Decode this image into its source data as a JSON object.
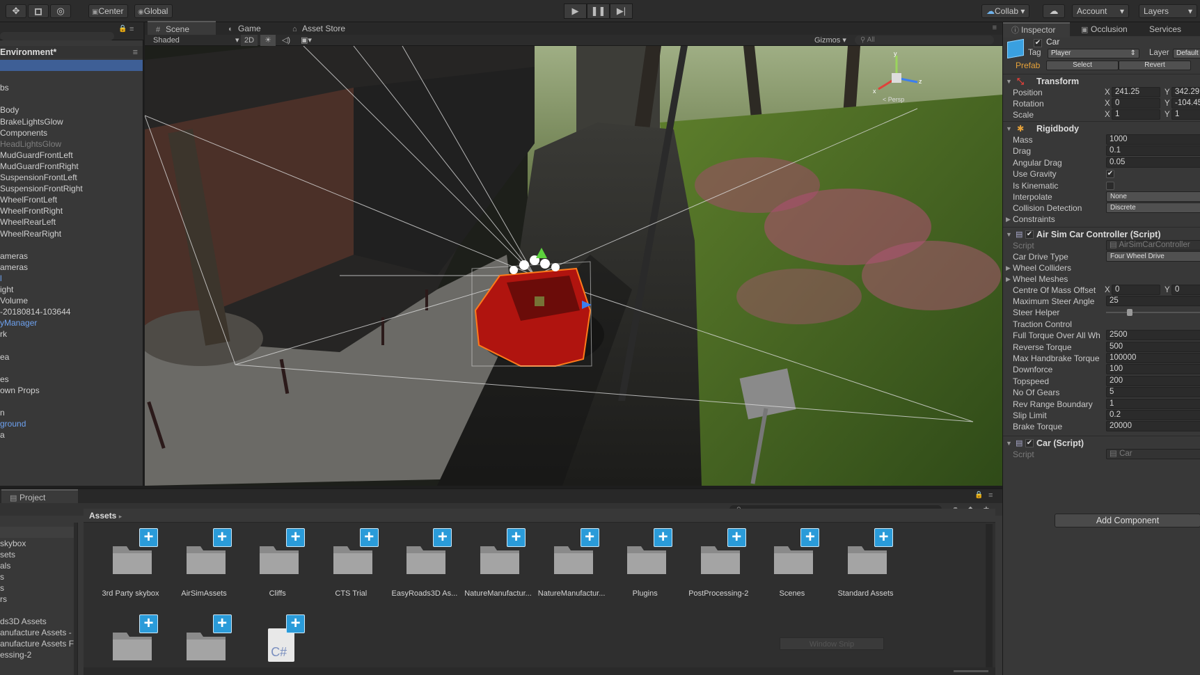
{
  "toolbar": {
    "pivot_center": "Center",
    "pivot_global": "Global",
    "collab": "Collab",
    "account": "Account",
    "layers": "Layers"
  },
  "scene_tabs": [
    "Scene",
    "Game",
    "Asset Store"
  ],
  "scene_toolbar": {
    "draw_mode": "Shaded",
    "mode_2d": "2D",
    "gizmos": "Gizmos",
    "search_placeholder": "All"
  },
  "hierarchy": {
    "title": "Environment*",
    "items": [
      {
        "label": "",
        "style": "sel"
      },
      {
        "label": "",
        "style": ""
      },
      {
        "label": "bs",
        "style": ""
      },
      {
        "label": "",
        "style": ""
      },
      {
        "label": "Body",
        "style": ""
      },
      {
        "label": "BrakeLightsGlow",
        "style": ""
      },
      {
        "label": "Components",
        "style": ""
      },
      {
        "label": "HeadLightsGlow",
        "style": "gray"
      },
      {
        "label": "MudGuardFrontLeft",
        "style": ""
      },
      {
        "label": "MudGuardFrontRight",
        "style": ""
      },
      {
        "label": "SuspensionFrontLeft",
        "style": ""
      },
      {
        "label": "SuspensionFrontRight",
        "style": ""
      },
      {
        "label": "WheelFrontLeft",
        "style": ""
      },
      {
        "label": "WheelFrontRight",
        "style": ""
      },
      {
        "label": "WheelRearLeft",
        "style": ""
      },
      {
        "label": "WheelRearRight",
        "style": ""
      },
      {
        "label": "",
        "style": ""
      },
      {
        "label": "ameras",
        "style": ""
      },
      {
        "label": "ameras",
        "style": ""
      },
      {
        "label": "l",
        "style": "blue"
      },
      {
        "label": "ight",
        "style": ""
      },
      {
        "label": " Volume",
        "style": ""
      },
      {
        "label": "-20180814-103644",
        "style": ""
      },
      {
        "label": "yManager",
        "style": "blue"
      },
      {
        "label": "rk",
        "style": ""
      },
      {
        "label": "",
        "style": ""
      },
      {
        "label": "ea",
        "style": ""
      },
      {
        "label": "",
        "style": ""
      },
      {
        "label": "es",
        "style": ""
      },
      {
        "label": "own Props",
        "style": ""
      },
      {
        "label": "",
        "style": ""
      },
      {
        "label": "n",
        "style": ""
      },
      {
        "label": "ground",
        "style": "blue"
      },
      {
        "label": "a",
        "style": ""
      }
    ]
  },
  "project": {
    "tab": "Project",
    "breadcrumb": "Assets",
    "left_items": [
      " skybox",
      "sets",
      "als",
      "s",
      "s",
      "rs",
      "",
      "ds3D Assets",
      "anufacture Assets -",
      "anufacture Assets F",
      "essing-2"
    ],
    "assets_row1": [
      "3rd Party skybox",
      "AirSimAssets",
      "Cliffs",
      "CTS Trial",
      "EasyRoads3D As...",
      "NatureManufactur...",
      "NatureManufactur...",
      "Plugins",
      "PostProcessing-2",
      "Scenes",
      "Standard Assets"
    ],
    "assets_row2": [
      "",
      "",
      ""
    ],
    "script_glyph": "C#",
    "window_snip": "Window Snip"
  },
  "inspector": {
    "tabs": [
      "Inspector",
      "Occlusion",
      "Services"
    ],
    "object_name": "Car",
    "tag_label": "Tag",
    "tag_value": "Player",
    "layer_label": "Layer",
    "layer_value": "Default",
    "prefab_label": "Prefab",
    "prefab_select": "Select",
    "prefab_revert": "Revert",
    "transform": {
      "title": "Transform",
      "position": {
        "label": "Position",
        "x": "241.25",
        "y": "342.29"
      },
      "rotation": {
        "label": "Rotation",
        "x": "0",
        "y": "-104.45"
      },
      "scale": {
        "label": "Scale",
        "x": "1",
        "y": "1"
      }
    },
    "rigidbody": {
      "title": "Rigidbody",
      "rows": [
        {
          "label": "Mass",
          "value": "1000",
          "kind": "field"
        },
        {
          "label": "Drag",
          "value": "0.1",
          "kind": "field"
        },
        {
          "label": "Angular Drag",
          "value": "0.05",
          "kind": "field"
        },
        {
          "label": "Use Gravity",
          "value": "✔",
          "kind": "check"
        },
        {
          "label": "Is Kinematic",
          "value": "",
          "kind": "check"
        },
        {
          "label": "Interpolate",
          "value": "None",
          "kind": "dropdown"
        },
        {
          "label": "Collision Detection",
          "value": "Discrete",
          "kind": "dropdown"
        }
      ],
      "constraints": "Constraints"
    },
    "controller": {
      "title": "Air Sim Car Controller (Script)",
      "script_label": "Script",
      "script_value": "AirSimCarController",
      "drive_type_label": "Car Drive Type",
      "drive_type_value": "Four Wheel Drive",
      "wheel_colliders": "Wheel Colliders",
      "wheel_meshes": "Wheel Meshes",
      "com_label": "Centre Of Mass Offset",
      "com_x": "0",
      "com_y": "0",
      "rows": [
        {
          "label": "Maximum Steer Angle",
          "value": "25",
          "kind": "field"
        },
        {
          "label": "Steer Helper",
          "value": "",
          "kind": "slider"
        },
        {
          "label": "Traction Control",
          "value": "",
          "kind": "slider"
        },
        {
          "label": "Full Torque Over All Wh",
          "value": "2500",
          "kind": "field"
        },
        {
          "label": "Reverse Torque",
          "value": "500",
          "kind": "field"
        },
        {
          "label": "Max Handbrake Torque",
          "value": "100000",
          "kind": "field"
        },
        {
          "label": "Downforce",
          "value": "100",
          "kind": "field"
        },
        {
          "label": "Topspeed",
          "value": "200",
          "kind": "field"
        },
        {
          "label": "No Of Gears",
          "value": "5",
          "kind": "field"
        },
        {
          "label": "Rev Range Boundary",
          "value": "1",
          "kind": "field"
        },
        {
          "label": "Slip Limit",
          "value": "0.2",
          "kind": "field"
        },
        {
          "label": "Brake Torque",
          "value": "20000",
          "kind": "field"
        }
      ]
    },
    "car_script": {
      "title": "Car (Script)",
      "script_label": "Script",
      "script_value": "Car"
    },
    "add_component": "Add Component",
    "gizmo_persp": "< Persp"
  },
  "colors": {
    "selection": "#3e5f96",
    "prefab": "#e8a33a",
    "accent_blue": "#2a9bd9",
    "hierarchy_blue_text": "#6ea2f0"
  }
}
